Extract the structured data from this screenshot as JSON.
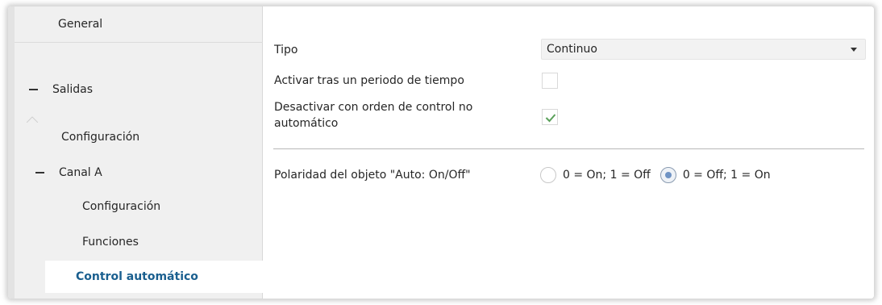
{
  "sidebar": {
    "items": [
      {
        "label": "General"
      },
      {
        "label": "Salidas"
      },
      {
        "label": "Configuración"
      },
      {
        "label": "Canal A"
      },
      {
        "label": "Configuración"
      },
      {
        "label": "Funciones"
      },
      {
        "label": "Control automático"
      }
    ]
  },
  "params": {
    "tipo": {
      "label": "Tipo",
      "value": "Continuo"
    },
    "activar": {
      "label": "Activar tras un periodo de tiempo",
      "checked": false
    },
    "desactivar": {
      "label_line1": "Desactivar con orden de control no",
      "label_line2": "automático",
      "checked": true
    },
    "polaridad": {
      "label": "Polaridad del objeto \"Auto: On/Off\"",
      "options": [
        "0 = On; 1 = Off",
        "0 = Off; 1 = On"
      ],
      "selected": "0 = Off; 1 = On"
    }
  },
  "colors": {
    "selected_text": "#1a5f8f",
    "check": "#5aa05a",
    "radio_dot": "#6f93c4"
  }
}
